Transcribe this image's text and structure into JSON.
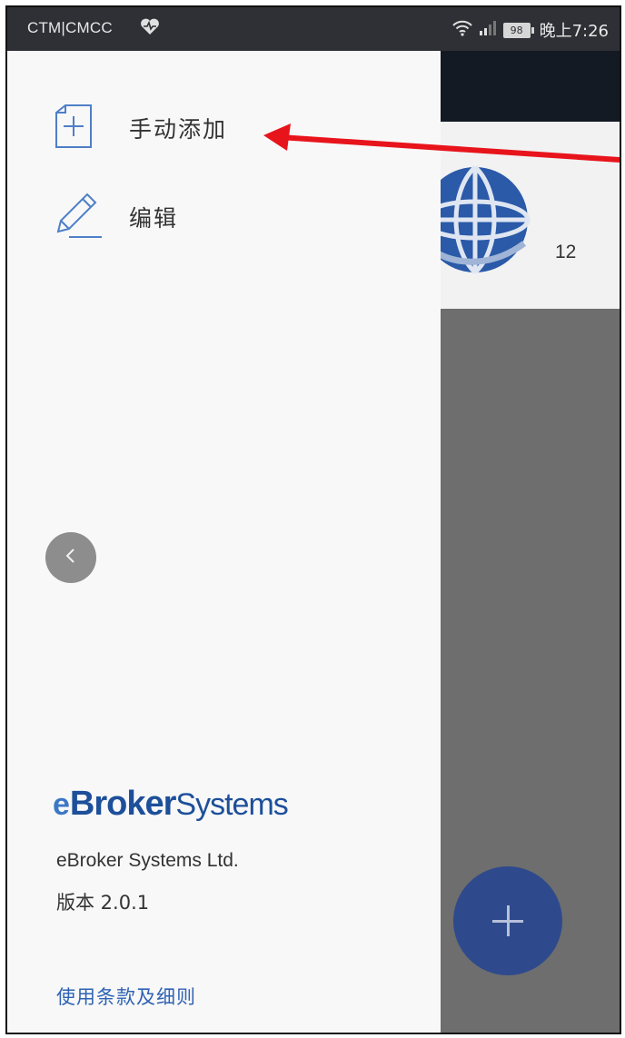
{
  "status_bar": {
    "carrier": "CTM|CMCC",
    "battery": "98",
    "time": "晚上7:26"
  },
  "drawer": {
    "menu": [
      {
        "label": "手动添加",
        "icon": "add-document-icon"
      },
      {
        "label": "编辑",
        "icon": "pencil-icon"
      }
    ],
    "collapse_icon": "chevron-left-icon",
    "logo": {
      "prefix": "e",
      "bold": "Broker",
      "regular": "Systems"
    },
    "company": "eBroker Systems Ltd.",
    "version": "版本 2.0.1",
    "terms_link": "使用条款及细则"
  },
  "background_app": {
    "row_value": "12",
    "fab_icon": "plus-icon"
  },
  "colors": {
    "status_bar": "#2f3035",
    "drawer_bg": "#f8f8f8",
    "brand_blue": "#1d4f9a",
    "link_blue": "#2f62b3",
    "fab": "#2f4a8c",
    "annotation_arrow": "#e8141c"
  }
}
